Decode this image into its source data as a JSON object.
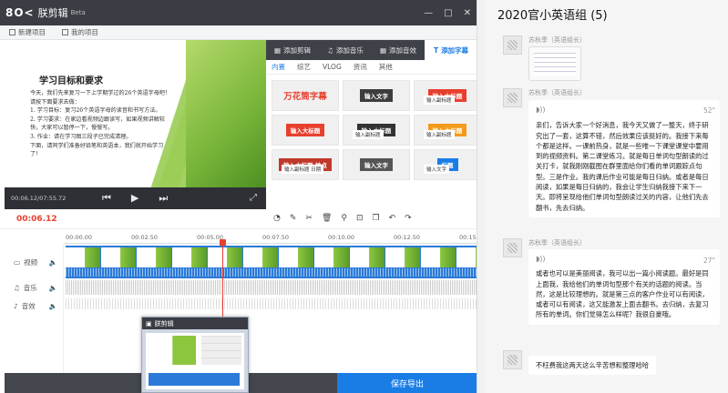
{
  "editor": {
    "logo": "8O<",
    "app_name": "朕剪辑",
    "beta": "Beta",
    "toolbar": {
      "new_project": "新建项目",
      "my_projects": "我的项目"
    },
    "preview": {
      "slide_title": "学习目标和要求",
      "slide_body": "今天，我们先来复习一下上学期学过的26个英语字母吧！\n请按下面要求去做：\n1. 学习目标：复习26个英语字母的读音和书写方法。\n2. 学习要求：在家边看视频边跟读写，如果视频讲解较\n快，大家可以暂停一下，慢慢写。\n3. 作业：请在学习图三段子已完成清理。\n下面，请同学们准备好铅笔和英语本，我们就开始学习\n了！",
      "time": "00:06.12/07:55.72"
    },
    "asset_tabs": [
      "添加剪辑",
      "添加音乐",
      "添加音效",
      "添加字幕"
    ],
    "active_tab": "添加字幕",
    "subtabs": [
      "内置",
      "综艺",
      "VLOG",
      "资讯",
      "其他"
    ],
    "active_subtab": "内置",
    "subtitle_tiles": [
      {
        "label": "万花筒字幕",
        "style": "big"
      },
      {
        "label": "输入文字",
        "color": "#3d3d3d"
      },
      {
        "label": "输入大标题",
        "sub": "输入副标题",
        "color": "#e8402f"
      },
      {
        "label": "输入大标题",
        "color": "#e8402f"
      },
      {
        "label": "输入大标题",
        "sub": "输入副标题",
        "color": "#333333"
      },
      {
        "label": "输入大标题",
        "sub": "输入副标题",
        "color": "#f39b1a"
      },
      {
        "label": "输入大标题 地点",
        "sub": "输入副标题 日期",
        "color": "#c0392b"
      },
      {
        "label": "输入文字",
        "color": "#555555"
      },
      {
        "label": "标题",
        "sub": "输入文字",
        "color": "#1a7de6"
      }
    ],
    "timeline": {
      "current_time": "00:06.12",
      "ruler": [
        "00:00.00",
        "00:02.50",
        "00:05.00",
        "00:07.50",
        "00:10.00",
        "00:12.50",
        "00:15.00"
      ],
      "tracks": [
        {
          "label": "视频",
          "icon": "video-icon"
        },
        {
          "label": "音乐",
          "icon": "music-icon"
        },
        {
          "label": "音效",
          "icon": "sfx-icon"
        }
      ]
    },
    "taskbar_thumb_title": "朕剪辑",
    "save_button": "保存导出"
  },
  "chat": {
    "title": "2020官小英语组 (5)",
    "messages": [
      {
        "sender": "苏秋季（英语组长）",
        "type": "image"
      },
      {
        "sender": "苏秋季（英语组长）",
        "type": "voice",
        "duration": "52\"",
        "text": "亲们，告诉大家一个好消息，我今天又做了一整天，终于研究出了一套，这算不错，然后效果应该挺好的。我接下来每个都是这样。一课前热身，就是一些唯一下课堂课堂中要用到的视频资料。第二课堂练习。就是每日单词句型朗读的过关打卡，就我刚刚截图在群里面给你们看的单词跟踪点句型。三是作业。我的课后作业可能是每日归纳。或者是每日阅读，如果是每日归纳的，我会让学生归纳我接下来下一天。即将呈现给他们单词句型朗读过关的内容，让他们先去翻书，先去归纳。"
      },
      {
        "sender": "苏秋季（英语组长）",
        "type": "voice",
        "duration": "27\"",
        "text": "或者也可以是美丽阅读，我可以出一篇小阅读题。最好是同上面我，我给他们的单词句型那个有关的话题的阅读。当然，这是比较理想的。就是第三点的客户作业可以有阅读，或者可以有阅读，这又能激发上面去翻书。去归纳，去复习所有的单词。你们觉得怎么样呢？我很自豪哦。"
      },
      {
        "sender": "",
        "type": "text",
        "text": "不枉费我这两天这么辛苦想和整理哈哈"
      }
    ]
  }
}
